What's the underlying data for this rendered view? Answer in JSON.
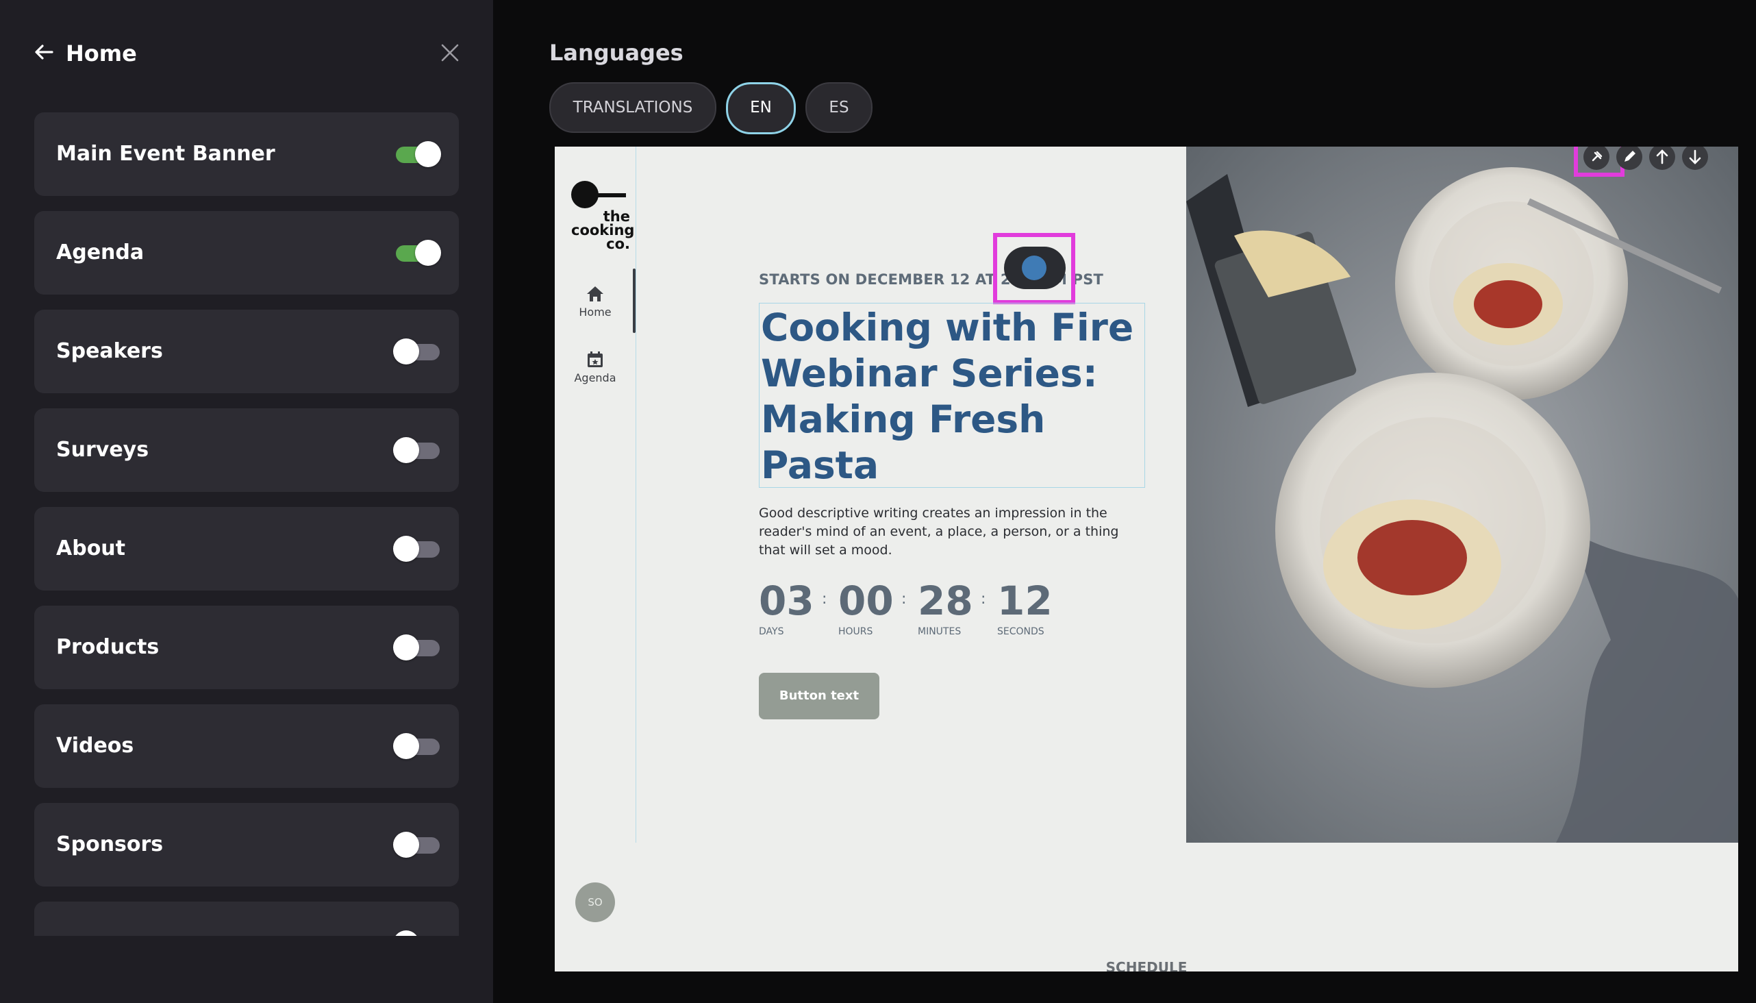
{
  "sidebar": {
    "title": "Home",
    "items": [
      {
        "label": "Main Event Banner",
        "enabled": true
      },
      {
        "label": "Agenda",
        "enabled": true
      },
      {
        "label": "Speakers",
        "enabled": false
      },
      {
        "label": "Surveys",
        "enabled": false
      },
      {
        "label": "About",
        "enabled": false
      },
      {
        "label": "Products",
        "enabled": false
      },
      {
        "label": "Videos",
        "enabled": false
      },
      {
        "label": "Sponsors",
        "enabled": false
      },
      {
        "label": "",
        "enabled": false
      }
    ]
  },
  "languages": {
    "title": "Languages",
    "tabs": [
      "TRANSLATIONS",
      "EN",
      "ES"
    ],
    "active": "EN"
  },
  "preview": {
    "logo_text": "the cooking co.",
    "nav": {
      "home": "Home",
      "agenda": "Agenda"
    },
    "starts_on": "STARTS ON DECEMBER 12 AT 2:00 PM PST",
    "title": "Cooking with Fire Webinar Series: Making Fresh Pasta",
    "description": "Good descriptive writing creates an impression in the reader's mind of an event, a place, a person, or a thing that will set a mood.",
    "countdown": {
      "days": "03",
      "days_label": "DAYS",
      "hours": "00",
      "hours_label": "HOURS",
      "minutes": "28",
      "minutes_label": "MINUTES",
      "seconds": "12",
      "seconds_label": "SECONDS"
    },
    "button_text": "Button text",
    "avatar_initials": "SO",
    "next_section": "SCHEDULE"
  },
  "colors": {
    "toggle_on": "#5aa84e",
    "title_blue": "#2d5885",
    "highlight": "#e13cdc",
    "active_tab_border": "#8fd3e8"
  }
}
